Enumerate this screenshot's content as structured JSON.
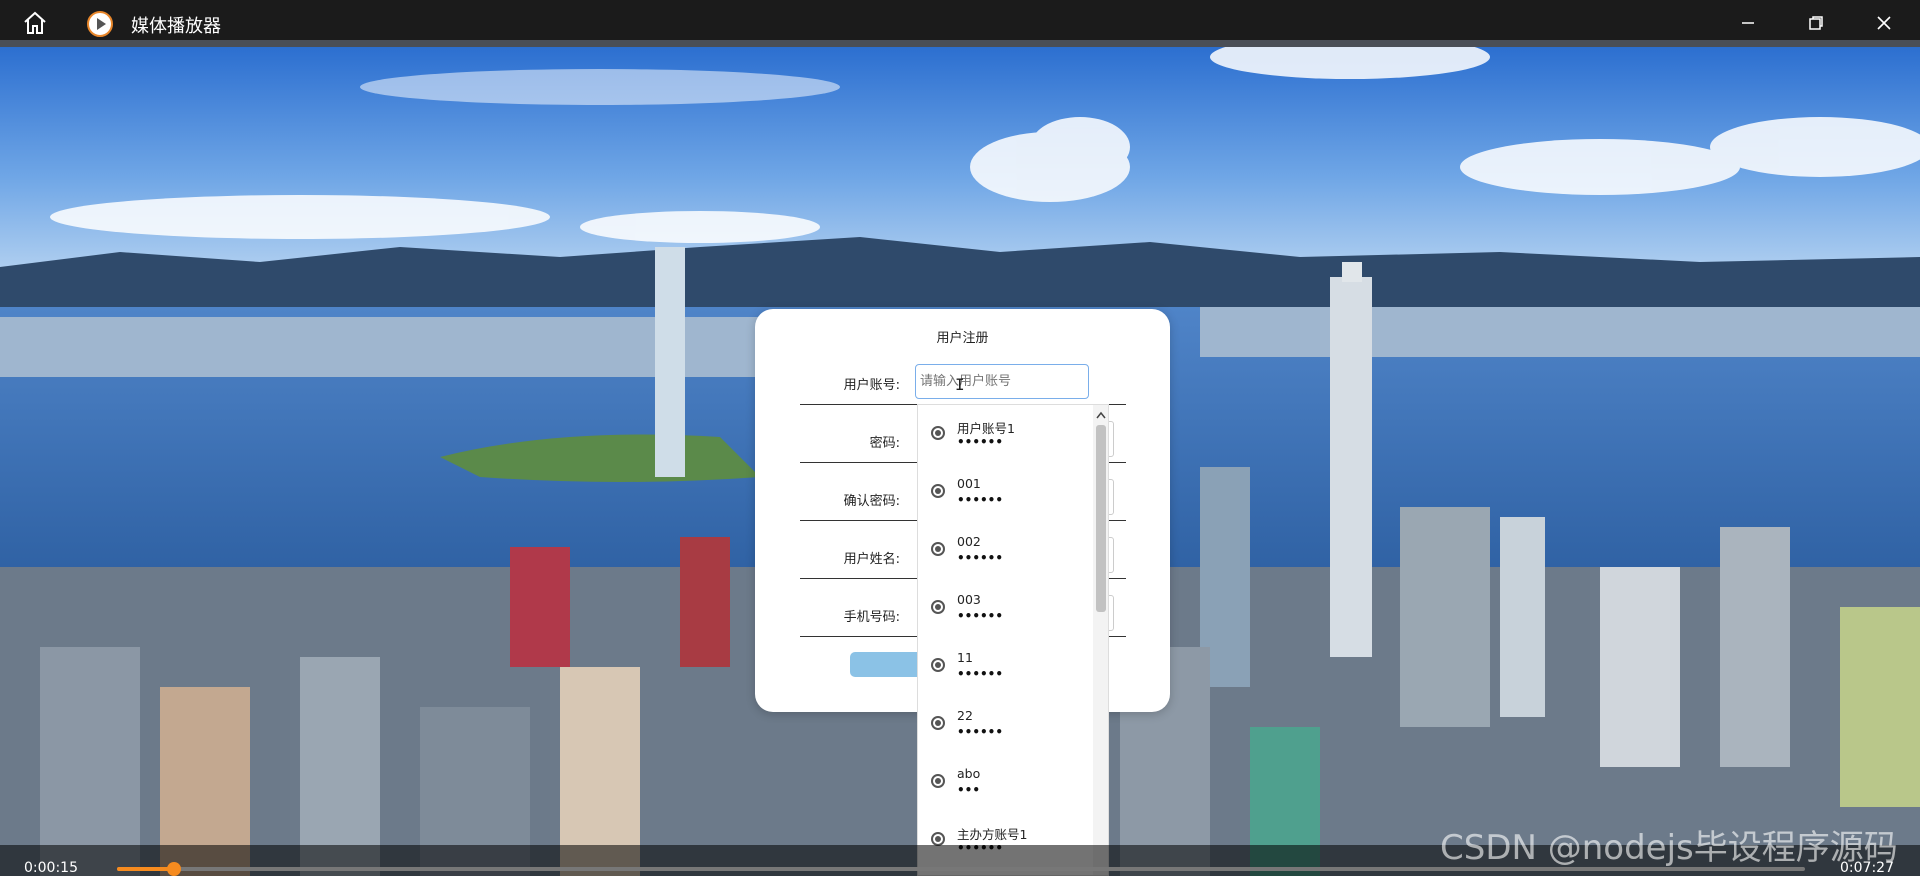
{
  "window": {
    "title": "媒体播放器",
    "home_icon": "home-icon",
    "app_icon": "play-icon",
    "minimize_icon": "minimize-icon",
    "maximize_icon": "restore-icon",
    "close_icon": "close-icon"
  },
  "dialog": {
    "title": "用户注册",
    "fields": [
      {
        "label": "用户账号:",
        "placeholder": "请输入用户账号"
      },
      {
        "label": "密码:"
      },
      {
        "label": "确认密码:"
      },
      {
        "label": "用户姓名:"
      },
      {
        "label": "手机号码:"
      }
    ],
    "submit_color": "#8bc2e6"
  },
  "autocomplete": {
    "items": [
      {
        "name": "用户账号1",
        "password": "••••••"
      },
      {
        "name": "001",
        "password": "••••••"
      },
      {
        "name": "002",
        "password": "••••••"
      },
      {
        "name": "003",
        "password": "••••••"
      },
      {
        "name": "11",
        "password": "••••••"
      },
      {
        "name": "22",
        "password": "••••••"
      },
      {
        "name": "abo",
        "password": "•••"
      },
      {
        "name": "主办方账号1",
        "password": "••••••"
      }
    ],
    "item_icon": "globe-icon"
  },
  "player": {
    "current_time": "0:00:15",
    "total_time": "0:07:27",
    "progress": 0.034,
    "progress_color": "#f68b1f"
  },
  "watermark": "CSDN @nodejs毕设程序源码"
}
